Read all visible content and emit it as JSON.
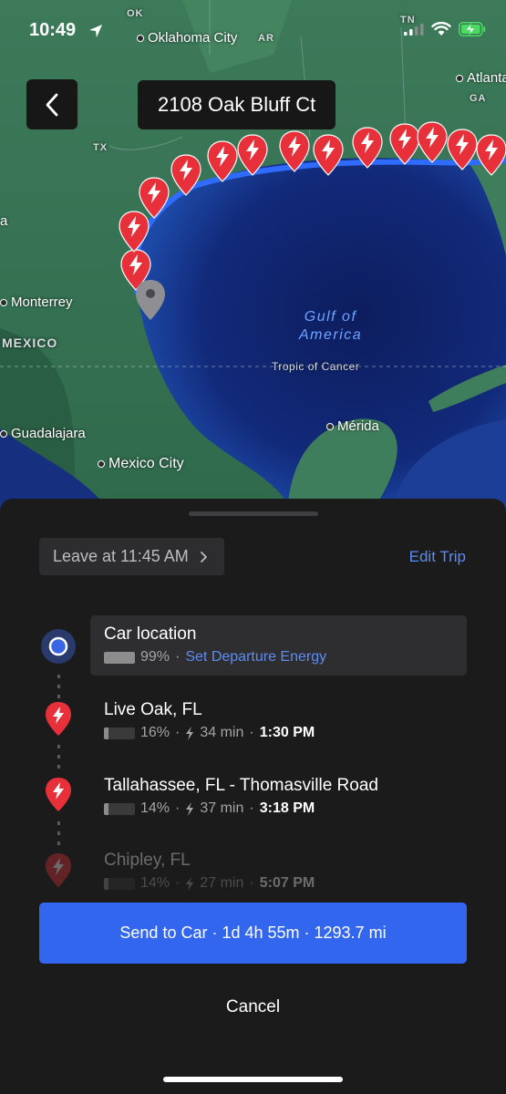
{
  "status_bar": {
    "time": "10:49",
    "icons": [
      "location-arrow-icon",
      "cellular-signal-icon",
      "wifi-icon",
      "battery-charging-icon"
    ]
  },
  "header": {
    "back_icon": "chevron-left-icon",
    "destination": "2108 Oak Bluff Ct"
  },
  "map": {
    "labels": {
      "ok": "OK",
      "oklahoma_city": "Oklahoma City",
      "ar": "AR",
      "tn": "TN",
      "atlanta": "Atlanta",
      "ga": "GA",
      "tx": "TX",
      "a": "a",
      "monterrey": "Monterrey",
      "mexico": "MEXICO",
      "gulf": "Gulf of\nAmerica",
      "tropic": "Tropic of Cancer",
      "merida": "Mérida",
      "guadalajara": "Guadalajara",
      "mexico_city": "Mexico City"
    },
    "charger_icon": "supercharger-pin-icon",
    "location_icon": "location-pin-icon",
    "route_color": "#2f6bff"
  },
  "panel": {
    "leave_label": "Leave at 11:45 AM",
    "leave_icon": "chevron-right-icon",
    "edit_trip": "Edit Trip",
    "stops": [
      {
        "name": "Car location",
        "battery_pct": "99%",
        "battery_level": 0.99,
        "action": "Set Departure Energy",
        "icon": "car-location-icon"
      },
      {
        "name": "Live Oak, FL",
        "battery_pct": "16%",
        "battery_level": 0.16,
        "charge_time": "34 min",
        "arrival": "1:30 PM",
        "icon": "supercharger-pin-icon"
      },
      {
        "name": "Tallahassee, FL - Thomasville Road",
        "battery_pct": "14%",
        "battery_level": 0.14,
        "charge_time": "37 min",
        "arrival": "3:18 PM",
        "icon": "supercharger-pin-icon"
      },
      {
        "name": "Chipley, FL",
        "battery_pct": "14%",
        "battery_level": 0.14,
        "charge_time": "27 min",
        "arrival": "5:07 PM",
        "icon": "supercharger-pin-icon"
      }
    ],
    "separator": "·",
    "send_button": "Send to Car · 1d 4h 55m · 1293.7 mi",
    "cancel_button": "Cancel",
    "colors": {
      "accent": "#3366ee",
      "link": "#5b8cf5",
      "charger_red": "#e8303a"
    }
  }
}
